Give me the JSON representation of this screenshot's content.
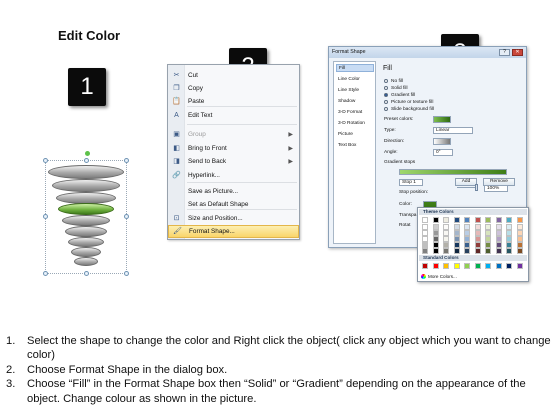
{
  "page": {
    "title": "Edit Color"
  },
  "badges": [
    "1",
    "2",
    "3"
  ],
  "context_menu": {
    "items": [
      {
        "label": "Cut",
        "icon": "scissors-icon",
        "glyph": "✂",
        "disabled": false,
        "submenu": false
      },
      {
        "label": "Copy",
        "icon": "copy-icon",
        "glyph": "❐",
        "disabled": false,
        "submenu": false
      },
      {
        "label": "Paste",
        "icon": "paste-icon",
        "glyph": "📋",
        "disabled": false,
        "submenu": false
      },
      {
        "label": "Edit Text",
        "icon": "edit-text-icon",
        "glyph": "A",
        "disabled": false,
        "submenu": false
      },
      {
        "label": "Group",
        "icon": "group-icon",
        "glyph": "▣",
        "disabled": true,
        "submenu": true
      },
      {
        "label": "Bring to Front",
        "icon": "bring-to-front-icon",
        "glyph": "◧",
        "disabled": false,
        "submenu": true
      },
      {
        "label": "Send to Back",
        "icon": "send-to-back-icon",
        "glyph": "◨",
        "disabled": false,
        "submenu": true
      },
      {
        "label": "Hyperlink...",
        "icon": "hyperlink-icon",
        "glyph": "🔗",
        "disabled": false,
        "submenu": false
      },
      {
        "label": "Save as Picture...",
        "icon": "",
        "glyph": "",
        "disabled": false,
        "submenu": false
      },
      {
        "label": "Set as Default Shape",
        "icon": "",
        "glyph": "",
        "disabled": false,
        "submenu": false
      },
      {
        "label": "Size and Position...",
        "icon": "size-position-icon",
        "glyph": "⊡",
        "disabled": false,
        "submenu": false
      },
      {
        "label": "Format Shape...",
        "icon": "format-shape-icon",
        "glyph": "🖌",
        "disabled": false,
        "submenu": false,
        "highlighted": true
      }
    ]
  },
  "dialog": {
    "title": "Format Shape",
    "nav": [
      "Fill",
      "Line Color",
      "Line Style",
      "Shadow",
      "3-D Format",
      "3-D Rotation",
      "Picture",
      "Text Box"
    ],
    "fill": {
      "heading": "Fill",
      "options": [
        "No fill",
        "Solid fill",
        "Gradient fill",
        "Picture or texture fill",
        "Slide background fill"
      ],
      "selected": "Gradient fill",
      "preset_colors_label": "Preset colors:",
      "type_label": "Type:",
      "type_value": "Linear",
      "direction_label": "Direction:",
      "angle_label": "Angle:",
      "angle_value": "0°",
      "gradient_stops_label": "Gradient stops",
      "stop_value": "Stop 1",
      "add_label": "Add",
      "remove_label": "Remove",
      "stop_position_label": "Stop position:",
      "stop_position_value": "100%",
      "color_label": "Color:",
      "transparency_label": "Transpa",
      "rotate_label": "Rotat"
    }
  },
  "color_popup": {
    "theme_heading": "Theme Colors",
    "standard_heading": "Standard Colors",
    "more_colors": "More Colors...",
    "theme_top": [
      "#ffffff",
      "#000000",
      "#eeece1",
      "#1f497d",
      "#4f81bd",
      "#c0504d",
      "#9bbb59",
      "#8064a2",
      "#4bacc6",
      "#f79646"
    ],
    "standard": [
      "#c00000",
      "#ff0000",
      "#ffc000",
      "#ffff00",
      "#92d050",
      "#00b050",
      "#00b0f0",
      "#0070c0",
      "#002060",
      "#7030a0"
    ]
  },
  "instructions": [
    {
      "num": "1.",
      "text": "Select the shape to change the color and Right click the object( click any object which you want to change color)"
    },
    {
      "num": "2.",
      "text": "Choose Format Shape in the dialog box."
    },
    {
      "num": "3.",
      "text": "Choose “Fill” in the Format Shape box then “Solid” or “Gradient” depending on the appearance of the object. Change colour as shown in the picture."
    }
  ]
}
